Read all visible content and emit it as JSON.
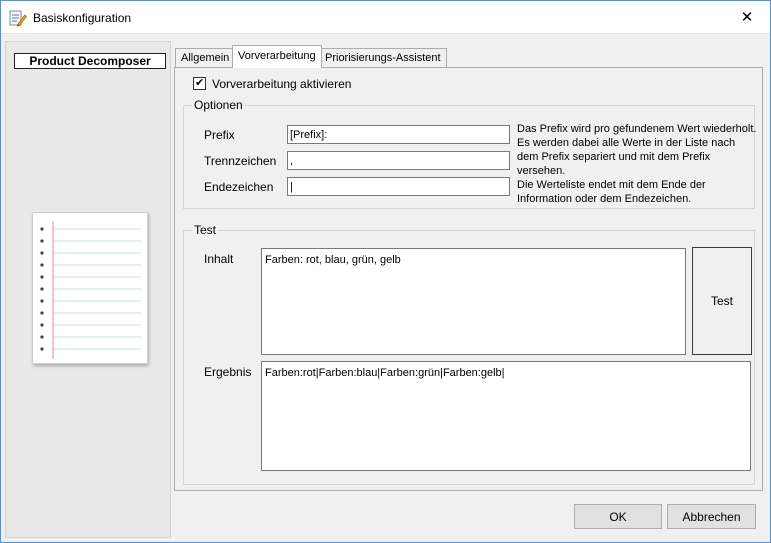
{
  "window": {
    "title": "Basiskonfiguration",
    "close_glyph": "✕"
  },
  "left_panel": {
    "product_label": "Product Decomposer",
    "illustration_icon": "notebook-icon"
  },
  "tabs": [
    {
      "label": "Allgemein",
      "active": false
    },
    {
      "label": "Vorverarbeitung",
      "active": true
    },
    {
      "label": "Priorisierungs-Assistent",
      "active": false
    }
  ],
  "preprocessing": {
    "enable_label": "Vorverarbeitung aktivieren",
    "enabled": true,
    "check_glyph": "✔"
  },
  "options": {
    "legend": "Optionen",
    "prefix_label": "Prefix",
    "prefix_value": "[Prefix]:",
    "separator_label": "Trennzeichen",
    "separator_value": ",",
    "end_label": "Endezeichen",
    "end_value": "|",
    "help_lines": [
      "Das Prefix wird pro gefundenem Wert wiederholt.",
      "Es werden dabei alle Werte in der Liste nach",
      "dem Prefix separiert und mit dem Prefix versehen.",
      "Die Werteliste endet mit dem Ende der",
      "Information oder dem Endezeichen."
    ]
  },
  "test": {
    "legend": "Test",
    "content_label": "Inhalt",
    "content_value": "Farben: rot, blau, grün, gelb",
    "test_button": "Test",
    "result_label": "Ergebnis",
    "result_value": "Farben:rot|Farben:blau|Farben:grün|Farben:gelb|"
  },
  "footer": {
    "ok_label": "OK",
    "cancel_label": "Abbrechen"
  },
  "colors": {
    "window_border": "#5f8fc9",
    "panel_bg": "#f0f0f0",
    "notebook_margin_red": "#e08a8a",
    "notebook_rule_blue": "#c7dbee"
  }
}
